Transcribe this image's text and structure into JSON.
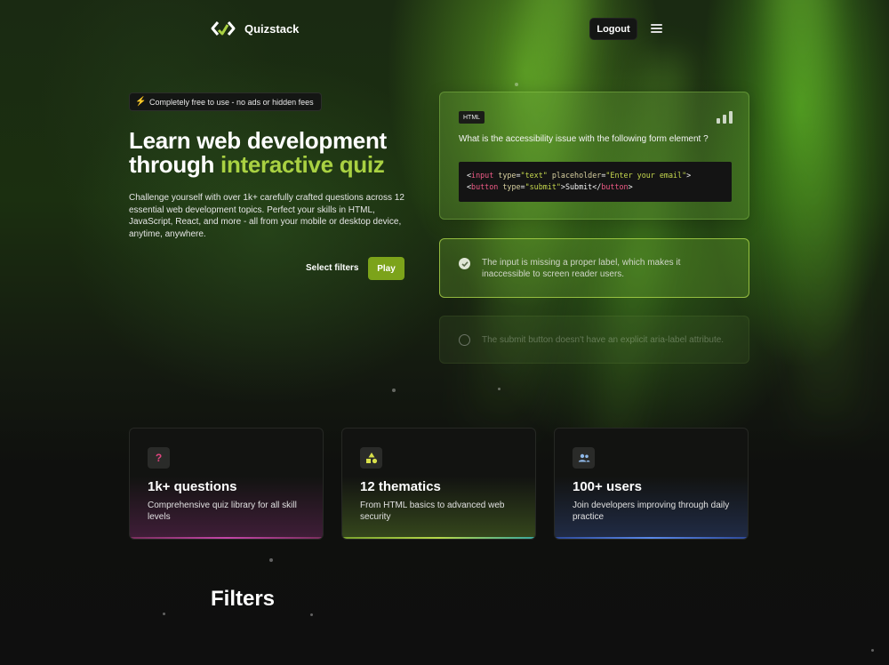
{
  "header": {
    "logo_text": "Quizstack",
    "logout_label": "Logout"
  },
  "hero": {
    "badge_text": "Completely free to use - no ads or hidden fees",
    "title_line1": "Learn web development",
    "title_line2_prefix": "through ",
    "title_highlight": "interactive quiz",
    "description": "Challenge yourself with over 1k+ carefully crafted questions across 12 essential web development topics. Perfect your skills in HTML, JavaScript, React, and more - all from your mobile or desktop device, anytime, anywhere.",
    "select_filters_label": "Select filters",
    "play_label": "Play"
  },
  "quiz": {
    "tag": "HTML",
    "question": "What is the accessibility issue with the following form element ?",
    "code_line1": {
      "open": "<",
      "tag": "input",
      "attr1": " type",
      "eq1": "=",
      "val1": "\"text\"",
      "attr2": " placeholder",
      "eq2": "=",
      "val2": "\"Enter your email\"",
      "close": ">"
    },
    "code_line2": {
      "open": "<",
      "tag": "button",
      "attr1": " type",
      "eq1": "=",
      "val1": "\"submit\"",
      "close": ">",
      "text": "Submit",
      "end_open": "</",
      "end_tag": "button",
      "end_close": ">"
    },
    "answers": [
      {
        "text": "The input is missing a proper label, which makes it inaccessible to screen reader users.",
        "selected": true
      },
      {
        "text": "The submit button doesn't have an explicit aria-label attribute.",
        "selected": false
      }
    ]
  },
  "stats": [
    {
      "icon": "question-icon",
      "icon_glyph": "?",
      "icon_color": "#e0457f",
      "title": "1k+ questions",
      "description": "Comprehensive quiz library for all skill levels",
      "accent": "#b23b8f"
    },
    {
      "icon": "shapes-icon",
      "icon_glyph": "",
      "icon_color": "#d8e04a",
      "title": "12 thematics",
      "description": "From HTML basics to advanced web security",
      "accent": "#8fc23a"
    },
    {
      "icon": "users-icon",
      "icon_glyph": "",
      "icon_color": "#8fb8e8",
      "title": "100+ users",
      "description": "Join developers improving through daily practice",
      "accent": "#4a78d8"
    }
  ],
  "filters_section": {
    "title": "Filters"
  },
  "colors": {
    "accent_green": "#a9d142",
    "play_button": "#7ca31a"
  }
}
